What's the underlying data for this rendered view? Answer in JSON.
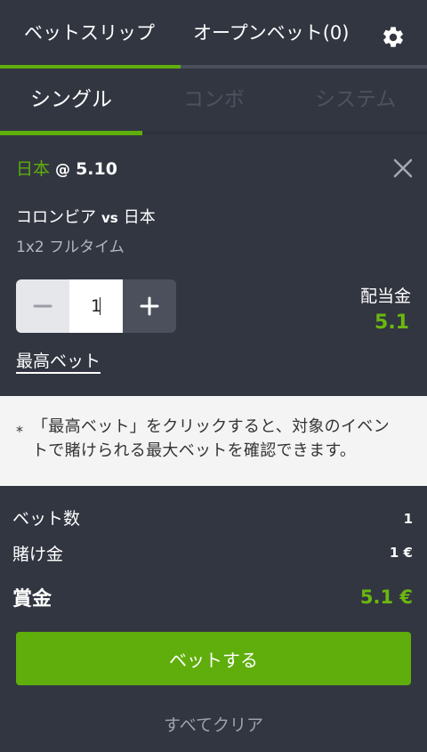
{
  "header": {
    "tabs": [
      {
        "label": "ベットスリップ",
        "active": true
      },
      {
        "label": "オープンベット(0)",
        "active": false
      }
    ],
    "settings_icon": "gear-icon"
  },
  "bet_type_tabs": [
    {
      "label": "シングル",
      "active": true
    },
    {
      "label": "コンボ",
      "active": false
    },
    {
      "label": "システム",
      "active": false
    }
  ],
  "selection": {
    "team": "日本",
    "at": "@",
    "odds": "5.10",
    "close_icon": "close-icon",
    "match_home": "コロンビア",
    "match_vs": "vs",
    "match_away": "日本",
    "market": "1x2 フルタイム"
  },
  "stake": {
    "value": "1",
    "minus_icon": "minus-icon",
    "plus_icon": "plus-icon"
  },
  "payout": {
    "label": "配当金",
    "value": "5.1"
  },
  "max_bet_link": "最高ベット",
  "info": {
    "bullet": "*",
    "text": "「最高ベット」をクリックすると、対象のイベントで賭けられる最大ベットを確認できます。"
  },
  "summary": {
    "bet_count_label": "ベット数",
    "bet_count_value": "1",
    "stake_label": "賭け金",
    "stake_value": "1 €",
    "winnings_label": "賞金",
    "winnings_value": "5.1 €"
  },
  "actions": {
    "place_bet": "ベットする",
    "clear_all": "すべてクリア"
  },
  "colors": {
    "background": "#323641",
    "accent": "#5fae0c",
    "info_background": "#f4f4f4"
  }
}
